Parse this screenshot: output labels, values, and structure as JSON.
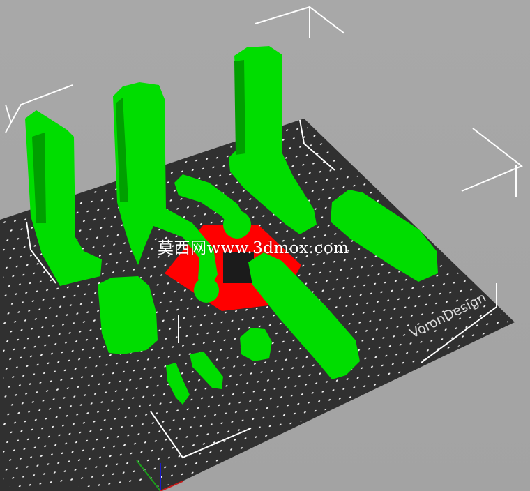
{
  "watermark": {
    "text": "莫西网www.3dmox.com"
  },
  "bed": {
    "brand_text": "VoronDesign"
  },
  "colors": {
    "background": "#a8a8a8",
    "bed": "#303030",
    "bed_dots": "#f2f2f2",
    "part_green": "#00dd00",
    "part_shade": "#009f00",
    "selection_red": "#ff0000",
    "bounding_box": "#ffffff"
  },
  "icons": {
    "axis_gizmo": "xyz-axis-icon"
  }
}
